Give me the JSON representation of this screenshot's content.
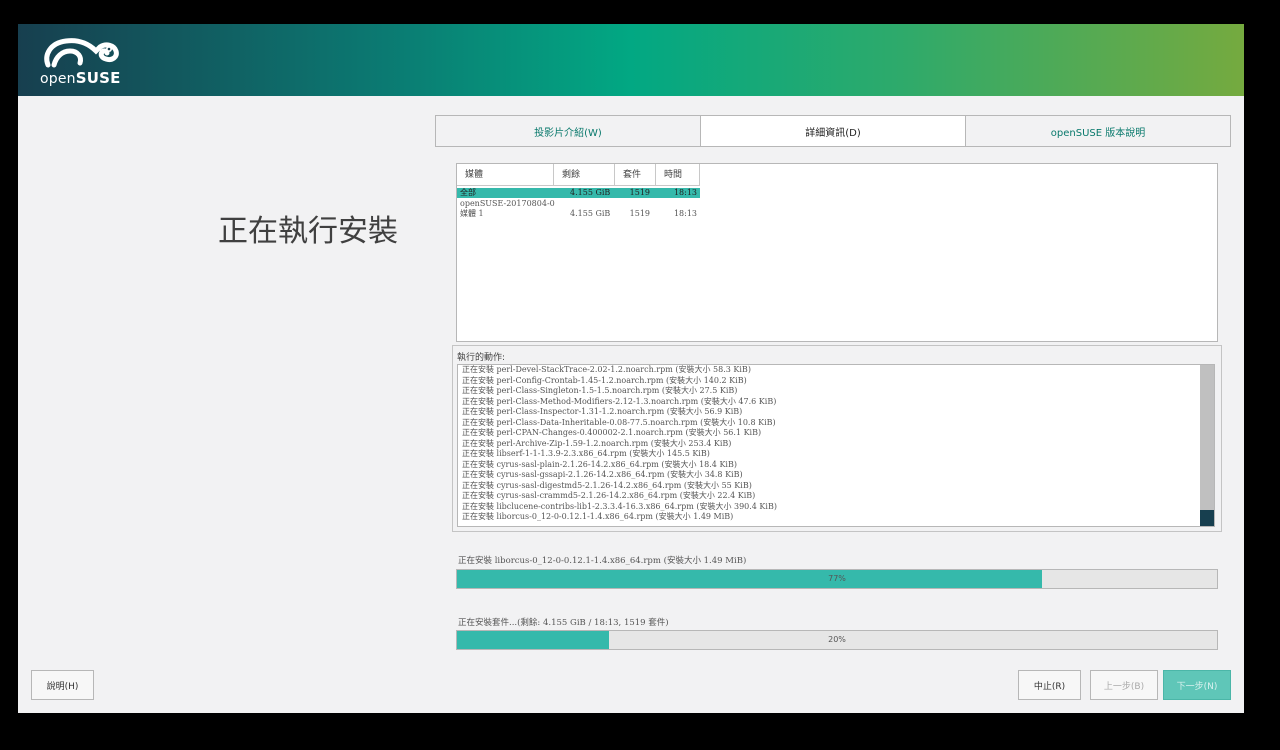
{
  "logo": {
    "text_light": "open",
    "text_bold": "SUSE"
  },
  "page_title": "正在執行安裝",
  "tabs": [
    {
      "label": "投影片介紹(W)",
      "active": false
    },
    {
      "label": "詳細資訊(D)",
      "active": true
    },
    {
      "label": "openSUSE 版本說明",
      "active": false
    }
  ],
  "media_table": {
    "headers": [
      "媒體",
      "剩餘",
      "套件",
      "時間"
    ],
    "rows": [
      {
        "name": "全部",
        "remaining": "4.155 GiB",
        "packages": "1519",
        "time": "18:13",
        "selected": true
      },
      {
        "name": "openSUSE-20170804-0",
        "remaining": "",
        "packages": "",
        "time": "",
        "selected": false
      },
      {
        "name": "媒體 1",
        "remaining": "4.155 GiB",
        "packages": "1519",
        "time": "18:13",
        "selected": false
      }
    ]
  },
  "actions": {
    "label": "執行的動作:",
    "lines": [
      "正在安裝 perl-Devel-StackTrace-2.02-1.2.noarch.rpm (安裝大小 58.3 KiB)",
      "正在安裝 perl-Config-Crontab-1.45-1.2.noarch.rpm (安裝大小 140.2 KiB)",
      "正在安裝 perl-Class-Singleton-1.5-1.5.noarch.rpm (安裝大小 27.5 KiB)",
      "正在安裝 perl-Class-Method-Modifiers-2.12-1.3.noarch.rpm (安裝大小 47.6 KiB)",
      "正在安裝 perl-Class-Inspector-1.31-1.2.noarch.rpm (安裝大小 56.9 KiB)",
      "正在安裝 perl-Class-Data-Inheritable-0.08-77.5.noarch.rpm (安裝大小 10.8 KiB)",
      "正在安裝 perl-CPAN-Changes-0.400002-2.1.noarch.rpm (安裝大小 56.1 KiB)",
      "正在安裝 perl-Archive-Zip-1.59-1.2.noarch.rpm (安裝大小 253.4 KiB)",
      "正在安裝 libserf-1-1-1.3.9-2.3.x86_64.rpm (安裝大小 145.5 KiB)",
      "正在安裝 cyrus-sasl-plain-2.1.26-14.2.x86_64.rpm (安裝大小 18.4 KiB)",
      "正在安裝 cyrus-sasl-gssapi-2.1.26-14.2.x86_64.rpm (安裝大小 34.8 KiB)",
      "正在安裝 cyrus-sasl-digestmd5-2.1.26-14.2.x86_64.rpm (安裝大小 55 KiB)",
      "正在安裝 cyrus-sasl-crammd5-2.1.26-14.2.x86_64.rpm (安裝大小 22.4 KiB)",
      "正在安裝 libclucene-contribs-lib1-2.3.3.4-16.3.x86_64.rpm (安裝大小 390.4 KiB)",
      "正在安裝 liborcus-0_12-0-0.12.1-1.4.x86_64.rpm (安裝大小 1.49 MiB)"
    ]
  },
  "package_progress": {
    "status": "正在安裝 liborcus-0_12-0-0.12.1-1.4.x86_64.rpm (安裝大小 1.49 MiB)",
    "percent": 77,
    "label": "77%"
  },
  "total_progress": {
    "status": "正在安裝套件...(剩餘: 4.155 GiB / 18:13, 1519 套件)",
    "percent": 20,
    "label": "20%"
  },
  "buttons": {
    "help": "說明(H)",
    "abort": "中止(R)",
    "back": "上一步(B)",
    "next": "下一步(N)"
  },
  "colors": {
    "accent": "#35b9ab",
    "banner_dark": "#173f4f",
    "banner_mid": "#02a883",
    "banner_light": "#75aa3f"
  }
}
